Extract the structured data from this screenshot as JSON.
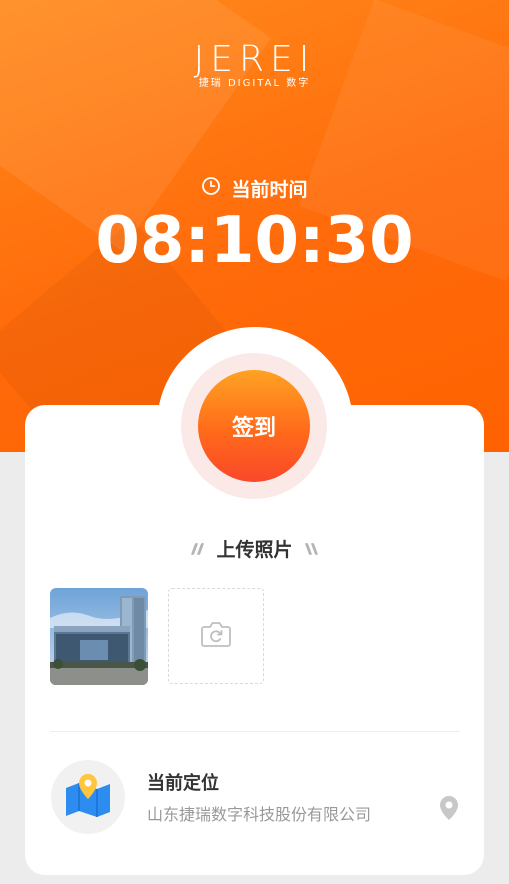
{
  "brand": {
    "logo_text": "JEREI",
    "logo_subtitle": "捷瑞 DIGITAL 数字"
  },
  "time": {
    "label": "当前时间",
    "value": "08:10:30"
  },
  "signin": {
    "button_label": "签到"
  },
  "upload": {
    "title": "上传照片"
  },
  "location": {
    "title": "当前定位",
    "address": "山东捷瑞数字科技股份有限公司"
  },
  "icons": {
    "time": "clock-icon",
    "camera": "camera-icon",
    "map": "map-icon",
    "pin": "location-pin-icon"
  },
  "colors": {
    "accent": "#ff6a0a",
    "button_top": "#ffa223",
    "button_bottom": "#f9482a",
    "map_blue": "#2d8cf0",
    "map_pin": "#ffc53d"
  }
}
